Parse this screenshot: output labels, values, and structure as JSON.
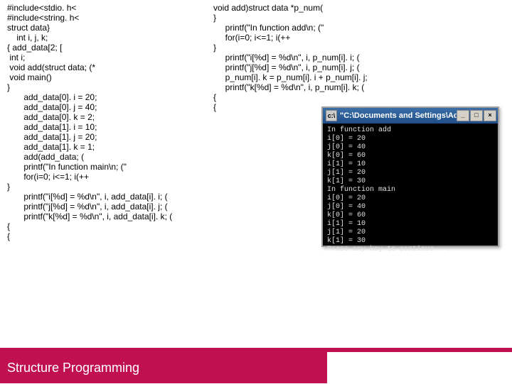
{
  "code_left": "#include<stdio. h<\n#include<string. h<\nstruct data}\n    int i, j, k;\n{ add_data[2; [\n int i;\n void add(struct data; (*\n void main()\n}\n       add_data[0]. i = 20;\n       add_data[0]. j = 40;\n       add_data[0]. k = 2;\n       add_data[1]. i = 10;\n       add_data[1]. j = 20;\n       add_data[1]. k = 1;\n       add(add_data; (\n       printf(\"In function main\\n; (\"\n       for(i=0; i<=1; i(++\n}\n       printf(\"i[%d] = %d\\n\", i, add_data[i]. i; (\n       printf(\"j[%d] = %d\\n\", i, add_data[i]. j; (\n       printf(\"k[%d] = %d\\n\", i, add_data[i]. k; (\n{\n{",
  "code_right": "void add)struct data *p_num(\n}\n     printf(\"In function add\\n; (\"\n     for(i=0; i<=1; i(++\n}\n     printf(\"i[%d] = %d\\n\", i, p_num[i]. i; (\n     printf(\"j[%d] = %d\\n\", i, p_num[i]. j; (\n     p_num[i]. k = p_num[i]. i + p_num[i]. j;\n     printf(\"k[%d] = %d\\n\", i, p_num[i]. k; (\n{\n{",
  "console": {
    "title_icon": "c:\\",
    "title": "\"C:\\Documents and Settings\\Administr...",
    "min": "_",
    "max": "□",
    "close": "×",
    "output": "In function add\ni[0] = 20\nj[0] = 40\nk[0] = 60\ni[1] = 10\nj[1] = 20\nk[1] = 30\nIn function main\ni[0] = 20\nj[0] = 40\nk[0] = 60\ni[1] = 10\nj[1] = 20\nk[1] = 30\nPress any key to continue . . ."
  },
  "footer": "Structure Programming"
}
